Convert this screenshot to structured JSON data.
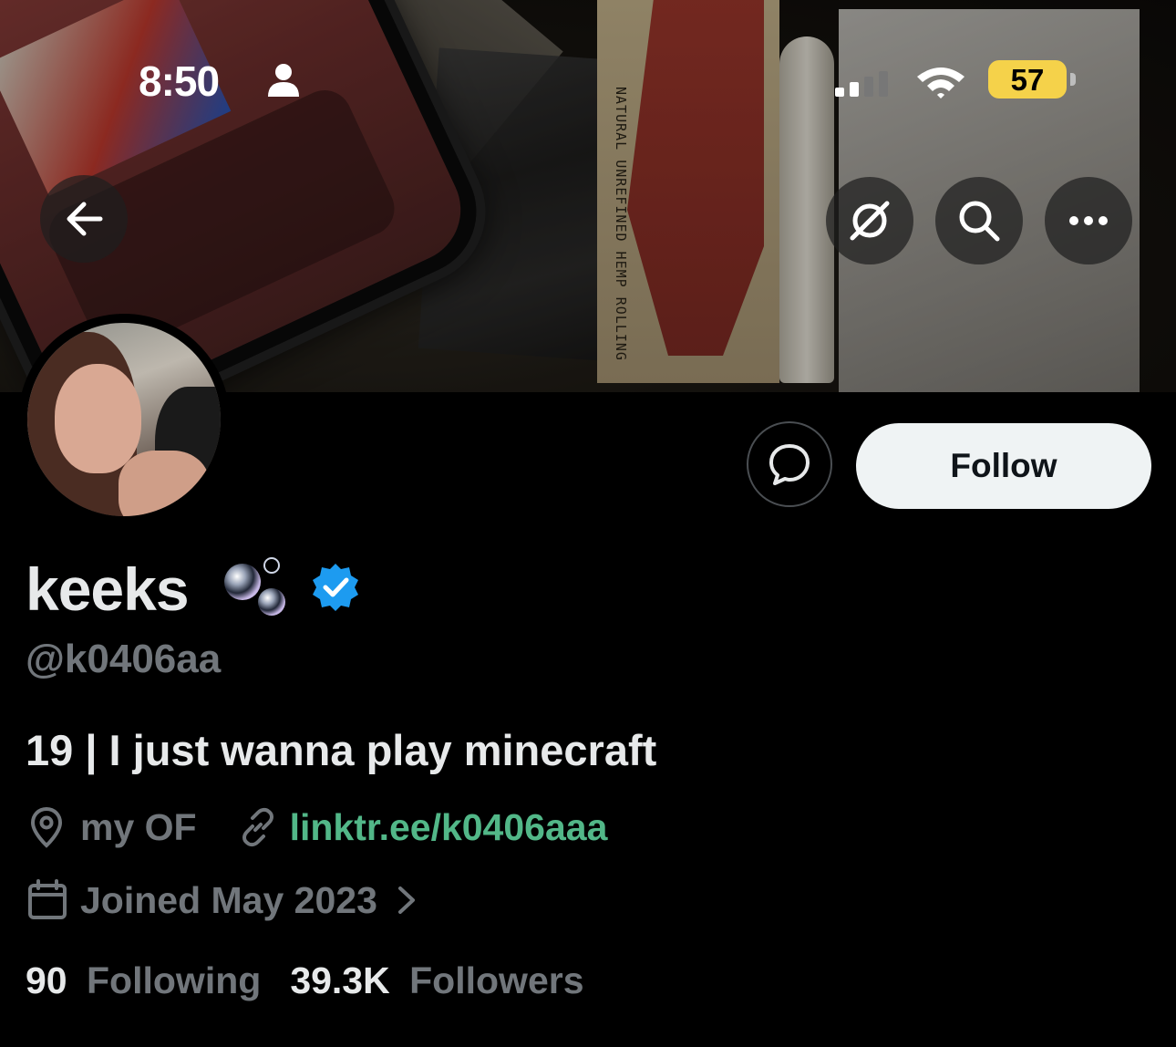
{
  "status_bar": {
    "time": "8:50",
    "battery": "57"
  },
  "banner": {
    "raw_box_text": "NATURAL UNREFINED HEMP ROLLING"
  },
  "profile": {
    "display_name": "keeks",
    "handle": "@k0406aa",
    "bio": "19 | I just wanna play minecraft",
    "location": "my OF",
    "website": "linktr.ee/k0406aaa",
    "joined": "Joined May 2023",
    "following_count": "90",
    "following_label": "Following",
    "followers_count": "39.3K",
    "followers_label": "Followers"
  },
  "actions": {
    "follow_label": "Follow"
  },
  "icons": {
    "back": "arrow-left-icon",
    "grok": "grok-icon",
    "search": "search-icon",
    "more": "more-icon",
    "message": "message-icon",
    "verified": "verified-badge-icon",
    "location": "location-pin-icon",
    "link": "link-icon",
    "calendar": "calendar-icon",
    "chevron": "chevron-right-icon"
  },
  "colors": {
    "background": "#000000",
    "text_primary": "#e7e9ea",
    "text_secondary": "#71767b",
    "link": "#52b788",
    "verified": "#1d9bf0",
    "follow_button_bg": "#eff3f4",
    "battery": "#f5d24a"
  }
}
